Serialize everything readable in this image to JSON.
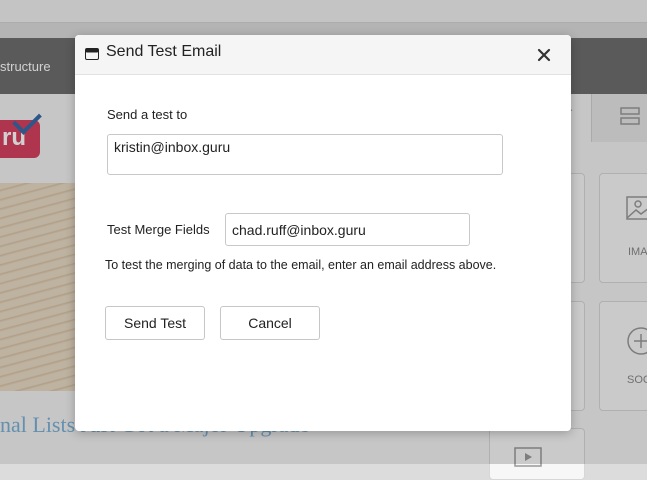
{
  "background": {
    "nav_label": "structure",
    "logo_text": "ru",
    "headline": "nal Lists Just Got a Major Upgrade",
    "tab_letter": "r",
    "tiles": [
      "IMA",
      "SOC"
    ]
  },
  "dialog": {
    "title": "Send Test Email",
    "send_to_label": "Send a test to",
    "send_to_value": "kristin@inbox.guru",
    "merge_label": "Test Merge Fields",
    "merge_value": "chad.ruff@inbox.guru",
    "help_text": "To test the merging of data to the email, enter an email address above.",
    "send_button": "Send Test",
    "cancel_button": "Cancel"
  },
  "colors": {
    "navbar": "#6e6e6e",
    "logo": "#d6405f",
    "headline": "#7ab0d6",
    "dialog_header": "#f5f5f5"
  },
  "icons": {
    "window": "window-icon",
    "close": "close-icon",
    "rows": "rows-icon",
    "image": "image-icon",
    "social": "plus-circle-icon",
    "video": "video-icon"
  }
}
